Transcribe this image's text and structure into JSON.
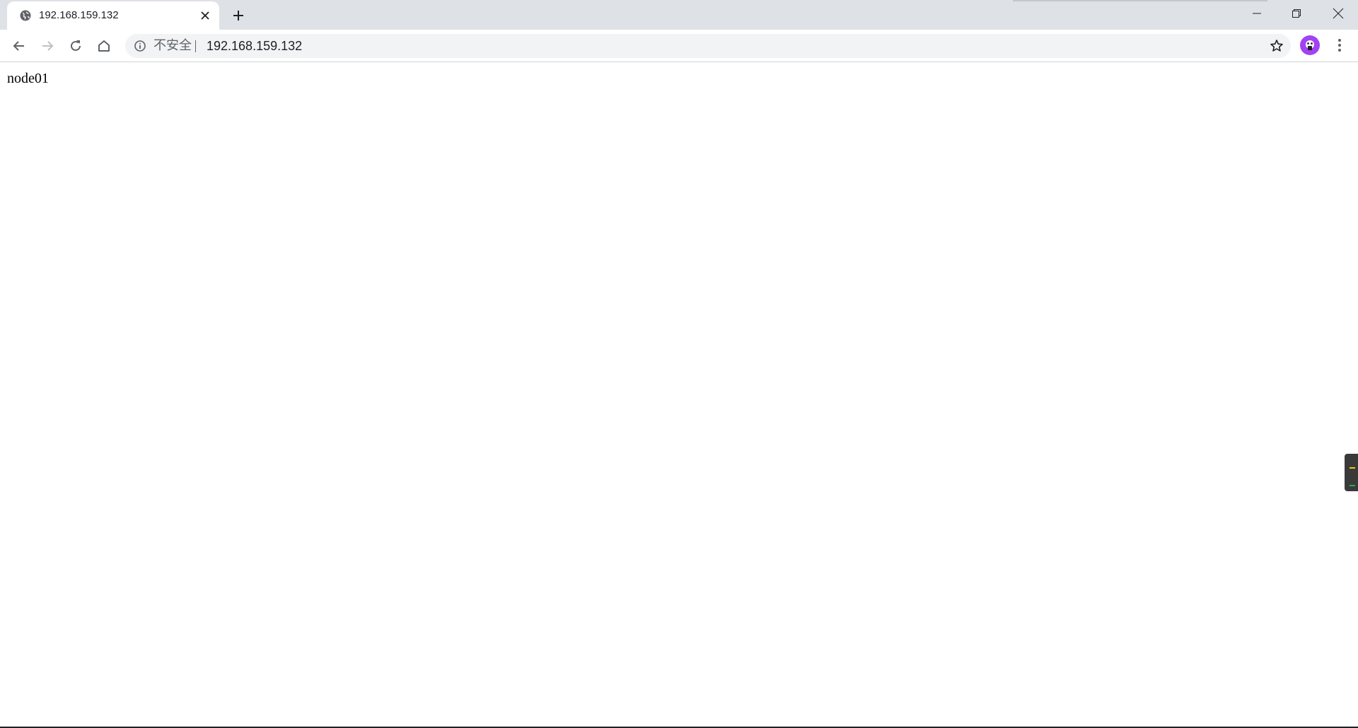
{
  "tab": {
    "title": "192.168.159.132",
    "favicon": "globe-icon",
    "close_icon": "close-icon"
  },
  "new_tab_icon": "plus-icon",
  "window_controls": [
    "minimize-icon",
    "restore-icon",
    "close-icon"
  ],
  "toolbar": {
    "back_icon": "arrow-left-icon",
    "forward_icon": "arrow-right-icon",
    "reload_icon": "reload-icon",
    "home_icon": "home-icon"
  },
  "omnibox": {
    "security_icon": "info-icon",
    "security_label": "不安全",
    "url": "192.168.159.132",
    "bookmark_icon": "star-icon"
  },
  "profile": {
    "icon": "avatar-icon",
    "color": "#a142f4"
  },
  "menu_icon": "more-vert-icon",
  "page": {
    "text": "node01"
  },
  "colors": {
    "tabstrip": "#dee1e6",
    "omnibox_bg": "#f1f3f4",
    "icon": "#5f6368",
    "accent_yellow": "#f9c513",
    "accent_green": "#34a853"
  }
}
